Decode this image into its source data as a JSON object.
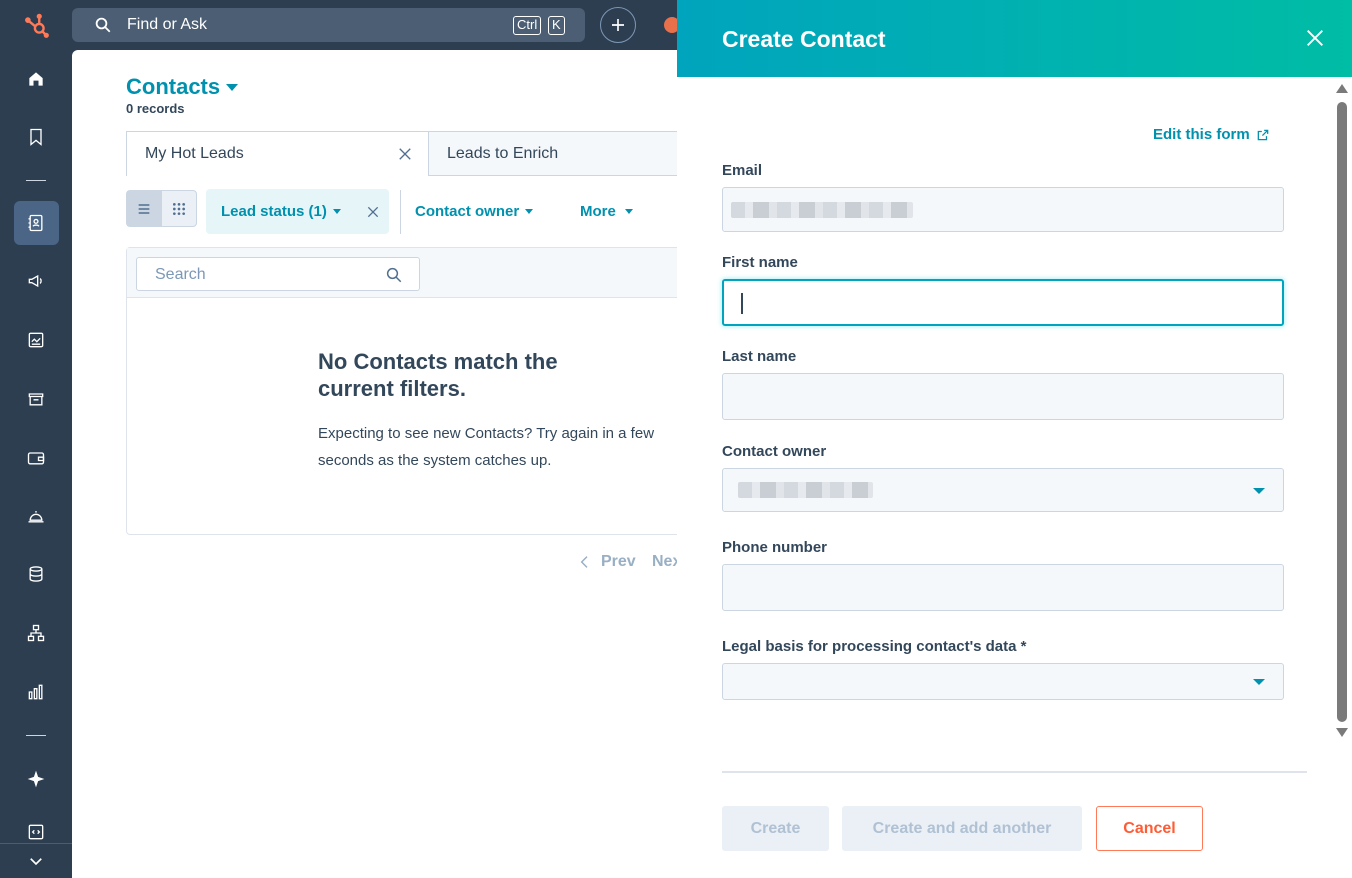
{
  "topbar": {
    "search_label": "Find or Ask",
    "kbd_ctrl": "Ctrl",
    "kbd_k": "K"
  },
  "nav": {
    "items": [
      "home-icon",
      "bookmark-icon",
      "contacts-icon",
      "marketing-icon",
      "content-icon",
      "commerce-icon",
      "payments-icon",
      "service-icon",
      "data-icon",
      "automation-icon",
      "reporting-icon",
      "breeze-icon",
      "developer-icon"
    ],
    "active": "contacts-icon"
  },
  "main": {
    "title": "Contacts",
    "records": "0 records",
    "tabs": [
      {
        "label": "My Hot Leads"
      },
      {
        "label": "Leads to Enrich"
      }
    ],
    "filters": {
      "lead_status": "Lead status (1)",
      "contact_owner": "Contact owner",
      "more": "More"
    },
    "search_placeholder": "Search",
    "empty_title": "No Contacts match the current filters.",
    "empty_text": "Expecting to see new Contacts? Try again in a few seconds as the system catches up.",
    "pager": {
      "prev": "Prev",
      "next": "Nex"
    }
  },
  "panel": {
    "title": "Create Contact",
    "edit_form": "Edit this form",
    "fields": {
      "email_label": "Email",
      "first_name_label": "First name",
      "last_name_label": "Last name",
      "owner_label": "Contact owner",
      "phone_label": "Phone number",
      "legal_label": "Legal basis for processing contact's data *"
    },
    "buttons": {
      "create": "Create",
      "create_another": "Create and add another",
      "cancel": "Cancel"
    }
  },
  "colors": {
    "accent": "#0091ae",
    "nav_bg": "#2d3e50",
    "header_gradient_start": "#00a4bd",
    "header_gradient_end": "#00bda5",
    "cancel": "#ff5c35"
  }
}
